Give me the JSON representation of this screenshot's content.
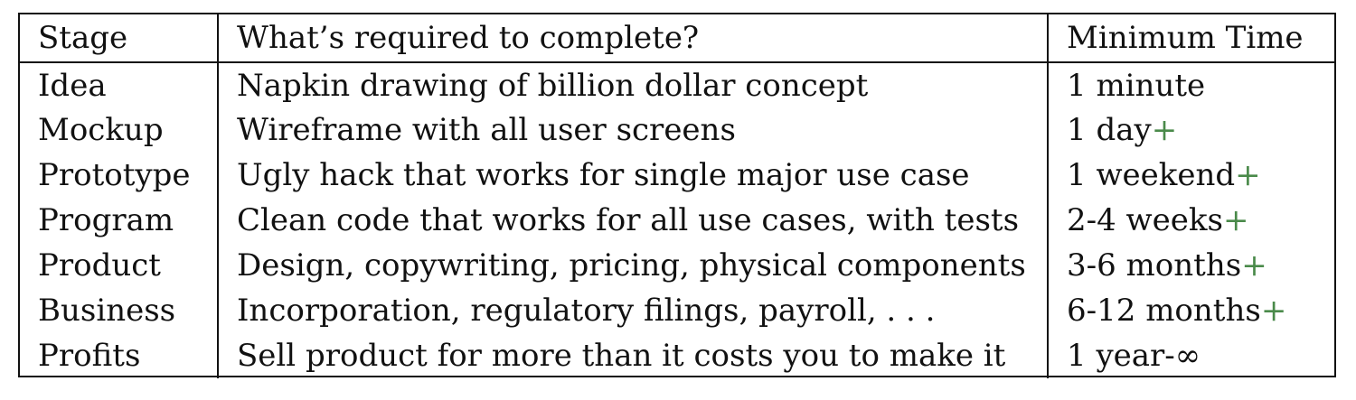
{
  "table": {
    "headers": [
      "Stage",
      "What’s required to complete?",
      "Minimum Time"
    ],
    "rows": [
      {
        "stage": "Idea",
        "requirement": "Napkin drawing of billion dollar concept",
        "time": "1 minute",
        "suffix": ""
      },
      {
        "stage": "Mockup",
        "requirement": "Wireframe with all user screens",
        "time": "1 day",
        "suffix": "+"
      },
      {
        "stage": "Prototype",
        "requirement": "Ugly hack that works for single major use case",
        "time": "1 weekend",
        "suffix": "+"
      },
      {
        "stage": "Program",
        "requirement": "Clean code that works for all use cases, with tests",
        "time": "2-4 weeks",
        "suffix": "+"
      },
      {
        "stage": "Product",
        "requirement": "Design, copywriting, pricing, physical components",
        "time": "3-6 months",
        "suffix": "+"
      },
      {
        "stage": "Business",
        "requirement": "Incorporation, regulatory filings, payroll, . . .",
        "time": "6-12 months",
        "suffix": "+"
      },
      {
        "stage": "Profits",
        "requirement": "Sell product for more than it costs you to make it",
        "time": "1 year-∞",
        "suffix": ""
      }
    ]
  },
  "colors": {
    "text": "#111111",
    "rule": "#111111",
    "plus": "#4a8a4a"
  }
}
